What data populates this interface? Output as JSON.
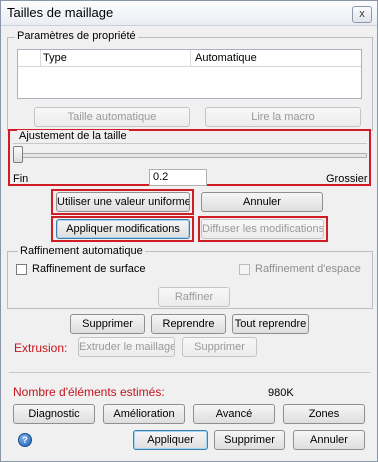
{
  "window": {
    "title": "Tailles de maillage",
    "close_label": "x"
  },
  "properties": {
    "group_label": "Paramètres de propriété",
    "col_type": "Type",
    "col_value": "Automatique",
    "btn_auto_size": "Taille automatique",
    "btn_read_macro": "Lire la macro"
  },
  "size_adjust": {
    "group_label": "Ajustement de la taille",
    "slider_value": 0.0,
    "fine_label": "Fin",
    "coarse_label": "Grossier",
    "value": "0.2"
  },
  "actions": {
    "btn_uniform": "Utiliser une valeur uniforme",
    "btn_cancel": "Annuler",
    "btn_apply_changes": "Appliquer modifications",
    "btn_broadcast": "Diffuser les modifications"
  },
  "refinement": {
    "group_label": "Raffinement automatique",
    "surface_label": "Raffinement de surface",
    "surface_checked": false,
    "space_label": "Raffinement d'espace",
    "space_checked": false,
    "btn_refine": "Raffiner"
  },
  "edit": {
    "btn_delete": "Supprimer",
    "btn_redo": "Reprendre",
    "btn_redo_all": "Tout reprendre"
  },
  "extrusion": {
    "label": "Extrusion:",
    "btn_extrude": "Extruder le maillage",
    "btn_delete": "Supprimer"
  },
  "estimate": {
    "label": "Nombre d'éléments estimés:",
    "value": "980K"
  },
  "tools": {
    "btn_diagnostic": "Diagnostic",
    "btn_improve": "Amélioration",
    "btn_advanced": "Avancé",
    "btn_zones": "Zones"
  },
  "footer": {
    "help_label": "?",
    "btn_apply": "Appliquer",
    "btn_delete": "Supprimer",
    "btn_cancel": "Annuler"
  },
  "colors": {
    "highlight": "#d01c24",
    "label_red": "#c2151b"
  }
}
